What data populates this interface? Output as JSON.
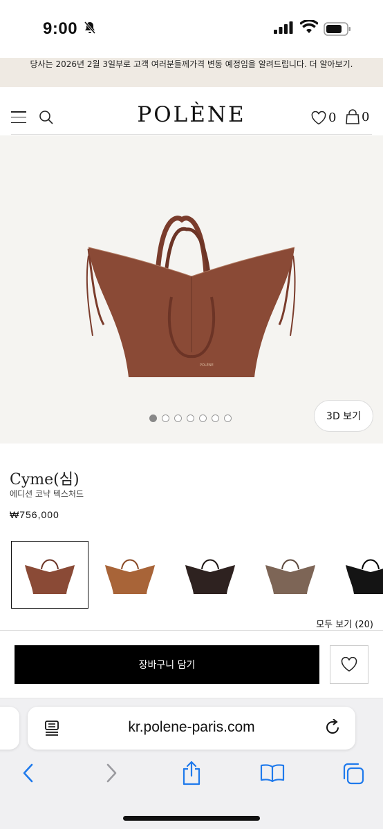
{
  "status_bar": {
    "time": "9:00"
  },
  "announcement": {
    "text": "당사는 2026년 2월 3일부로 고객 여러분들께가격 변동 예정임을 알려드립니다. 더 알아보기."
  },
  "header": {
    "logo": "POLÈNE",
    "wishlist_count": "0",
    "cart_count": "0"
  },
  "gallery": {
    "dot_count": 7,
    "active_dot": 1,
    "view_3d_label": "3D 보기"
  },
  "product": {
    "name": "Cyme(심)",
    "description": "에디션 코냑 텍스처드",
    "price": "₩756,000"
  },
  "colors": {
    "swatches": [
      "cognac",
      "camel",
      "dark-chocolate",
      "taupe",
      "black"
    ],
    "selected": "cognac",
    "hex": {
      "cognac": "#8a4a36",
      "camel": "#a86438",
      "dark-chocolate": "#2e2220",
      "taupe": "#7d6556",
      "black": "#141414"
    },
    "see_all_label": "모두 보기 (20)"
  },
  "actions": {
    "add_to_cart_label": "장바구니 담기"
  },
  "browser": {
    "url": "kr.polene-paris.com"
  },
  "accent": {
    "ios_blue": "#1f7aec",
    "bag_color": "#8a4a36"
  }
}
